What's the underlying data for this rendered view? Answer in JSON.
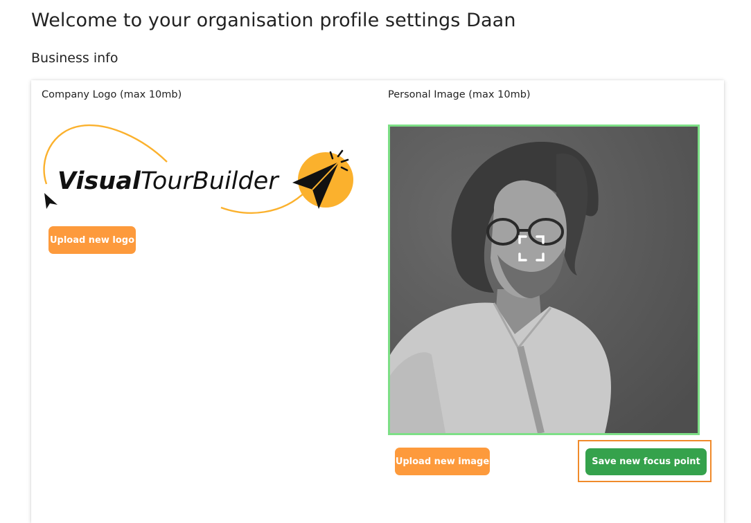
{
  "header": {
    "title": "Welcome to your organisation profile settings Daan",
    "section_title": "Business info"
  },
  "company_logo": {
    "label": "Company Logo (max 10mb)",
    "logo_text_bold": "Visual",
    "logo_text_regular": "TourBuilder",
    "upload_button": "Upload new logo"
  },
  "personal_image": {
    "label": "Personal Image (max 10mb)",
    "upload_button": "Upload new image",
    "save_focus_button": "Save new focus point",
    "focus_icon": "focus-point-icon"
  },
  "colors": {
    "orange_button": "#fd9a3c",
    "green_button": "#35a24c",
    "image_border": "#7ddf86",
    "highlight_border": "#f08a2a",
    "logo_accent": "#fbb12d"
  }
}
